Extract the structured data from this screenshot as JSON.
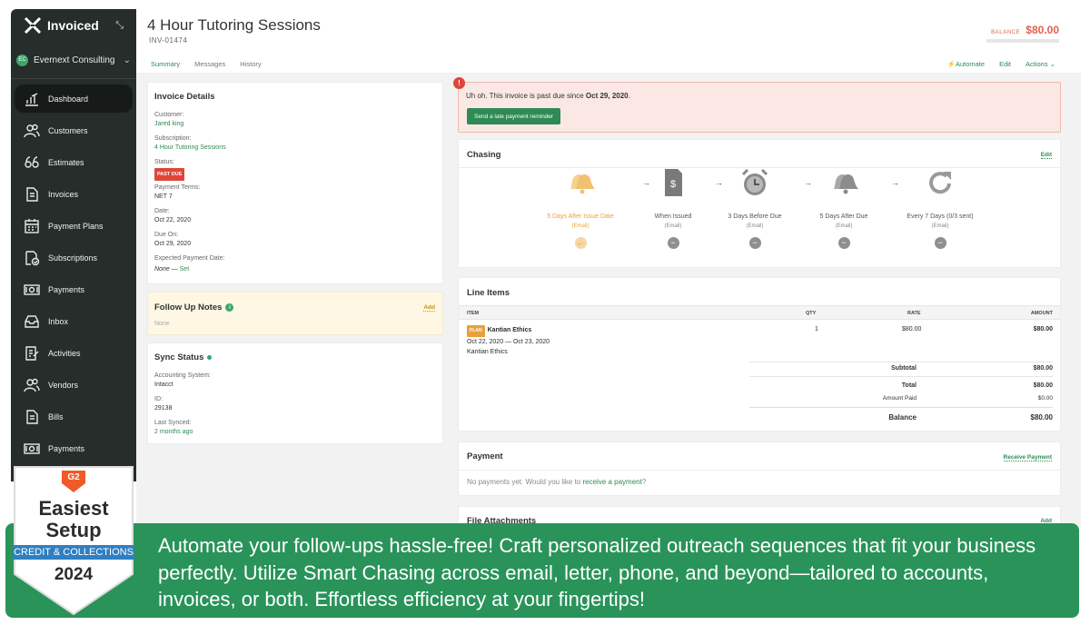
{
  "app": {
    "name": "Invoiced",
    "org": "Evernext Consulting",
    "org_initials": "EC"
  },
  "sidebar": {
    "items": [
      {
        "label": "Dashboard",
        "icon": "dashboard-icon"
      },
      {
        "label": "Customers",
        "icon": "customers-icon"
      },
      {
        "label": "Estimates",
        "icon": "estimates-icon"
      },
      {
        "label": "Invoices",
        "icon": "invoices-icon"
      },
      {
        "label": "Payment Plans",
        "icon": "calendar-icon"
      },
      {
        "label": "Subscriptions",
        "icon": "subscriptions-icon"
      },
      {
        "label": "Payments",
        "icon": "payments-icon"
      },
      {
        "label": "Inbox",
        "icon": "inbox-icon"
      },
      {
        "label": "Activities",
        "icon": "activities-icon"
      },
      {
        "label": "Vendors",
        "icon": "vendors-icon"
      },
      {
        "label": "Bills",
        "icon": "bills-icon"
      },
      {
        "label": "Payments",
        "icon": "payments-icon"
      }
    ]
  },
  "header": {
    "title": "4 Hour Tutoring Sessions",
    "invoice_number": "INV-01474",
    "balance_label": "BALANCE",
    "balance_value": "$80.00",
    "tabs": [
      "Summary",
      "Messages",
      "History"
    ],
    "actions": {
      "automate": "Automate",
      "edit": "Edit",
      "actions": "Actions"
    }
  },
  "invoice_details": {
    "heading": "Invoice Details",
    "customer_label": "Customer:",
    "customer": "Jared king",
    "subscription_label": "Subscription:",
    "subscription": "4 Hour Tutoring Sessions",
    "status_label": "Status:",
    "status": "PAST DUE",
    "terms_label": "Payment Terms:",
    "terms": "NET 7",
    "date_label": "Date:",
    "date": "Oct 22, 2020",
    "due_label": "Due On:",
    "due": "Oct 29, 2020",
    "expected_label": "Expected Payment Date:",
    "expected": "None —",
    "expected_set": "Set"
  },
  "follow_up": {
    "heading": "Follow Up Notes",
    "add": "Add",
    "body": "None"
  },
  "sync": {
    "heading": "Sync Status",
    "system_label": "Accounting System:",
    "system": "Intacct",
    "id_label": "ID:",
    "id": "29138",
    "last_label": "Last Synced:",
    "last": "2 months ago"
  },
  "alert": {
    "message_prefix": "Uh oh. This invoice is past due since ",
    "message_date": "Oct 29, 2020",
    "message_suffix": ".",
    "button": "Send a late payment reminder"
  },
  "chasing": {
    "heading": "Chasing",
    "edit": "Edit",
    "steps": [
      {
        "title": "5 Days After Issue Date",
        "channel": "(Email)"
      },
      {
        "title": "When Issued",
        "channel": "(Email)"
      },
      {
        "title": "3 Days Before Due",
        "channel": "(Email)"
      },
      {
        "title": "5 Days After Due",
        "channel": "(Email)"
      },
      {
        "title": "Every 7 Days (0/3 sent)",
        "channel": "(Email)"
      }
    ]
  },
  "line_items": {
    "heading": "Line Items",
    "columns": [
      "ITEM",
      "QTY",
      "RATE",
      "AMOUNT"
    ],
    "rows": [
      {
        "tag": "PLAN",
        "name": "Kantian Ethics",
        "period": "Oct 22, 2020 — Oct 23, 2020",
        "desc": "Kantian Ethics",
        "qty": "1",
        "rate": "$80.00",
        "amount": "$80.00"
      }
    ],
    "subtotal_label": "Subtotal",
    "subtotal": "$80.00",
    "total_label": "Total",
    "total": "$80.00",
    "paid_label": "Amount Paid",
    "paid": "$0.00",
    "balance_label": "Balance",
    "balance": "$80.00"
  },
  "payment": {
    "heading": "Payment",
    "receive": "Receive Payment",
    "empty_prefix": "No payments yet. Would you like to ",
    "empty_link": "receive a payment",
    "empty_suffix": "?"
  },
  "attachments": {
    "heading": "File Attachments",
    "add": "Add"
  },
  "badge": {
    "brand": "G2",
    "line1": "Easiest",
    "line2": "Setup",
    "category": "CREDIT & COLLECTIONS",
    "year": "2024"
  },
  "promo": {
    "text": "Automate your follow-ups hassle-free! Craft personalized outreach sequences that fit your business perfectly. Utilize Smart Chasing across email, letter, phone, and beyond—tailored to accounts, invoices, or both. Effortless efficiency at your fingertips!"
  },
  "colors": {
    "accent": "#2f8a55",
    "sidebar": "#262d2a",
    "danger": "#e0453a",
    "warning": "#e9a13d",
    "promo": "#29935a"
  }
}
